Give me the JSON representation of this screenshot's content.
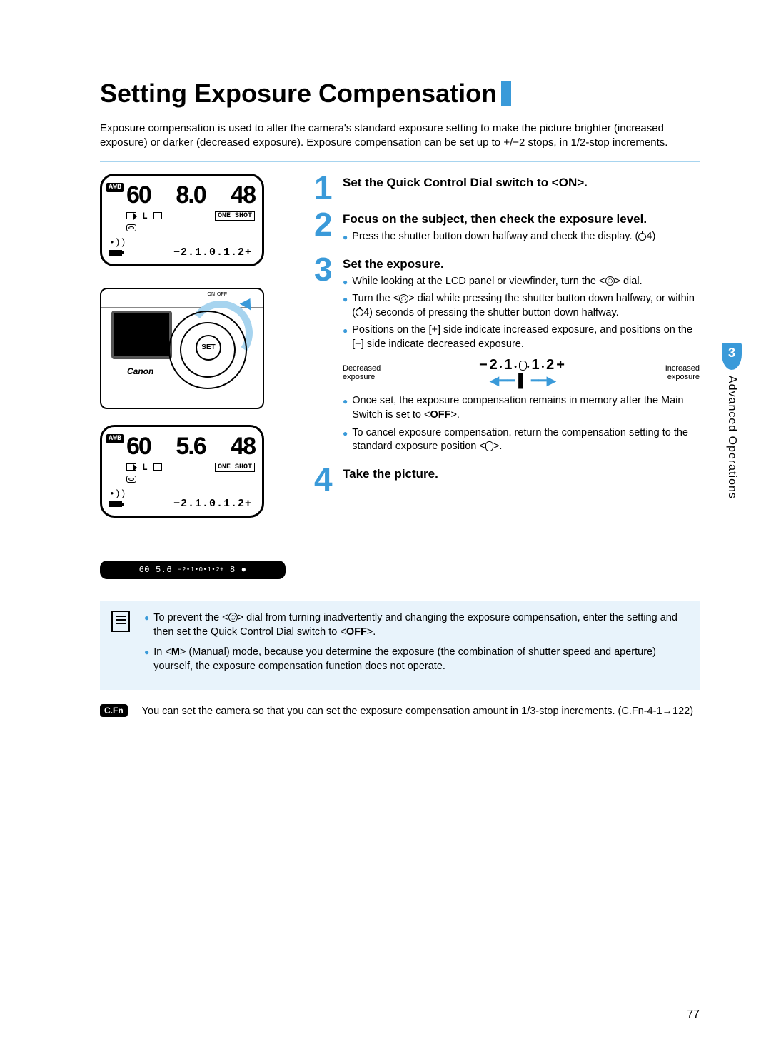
{
  "title": "Setting Exposure Compensation",
  "intro": "Exposure compensation is used to alter the camera's standard exposure setting to make the picture brighter (increased exposure) or darker (decreased exposure). Exposure compensation can be set up to +/−2 stops, in 1/2-stop increments.",
  "lcd1": {
    "awb": "AWB",
    "shutter": "60",
    "aperture": "8.0",
    "shots": "48",
    "oneshot": "ONE SHOT",
    "scale": "−2.1.0.1.2+"
  },
  "camera": {
    "brand": "Canon",
    "set": "SET",
    "switch_on": "ON",
    "switch_off": "OFF"
  },
  "lcd2": {
    "awb": "AWB",
    "shutter": "60",
    "aperture": "5.6",
    "shots": "48",
    "oneshot": "ONE SHOT",
    "scale": "−2.1.0.1.2+"
  },
  "viewfinder": {
    "shutter": "60",
    "aperture": "5.6",
    "scale": "−2•1•0•1•2+",
    "shots": "8",
    "dot": "●"
  },
  "steps": [
    {
      "n": "1",
      "title": "Set the Quick Control Dial switch to <ON>."
    },
    {
      "n": "2",
      "title": "Focus on the subject, then check the exposure level.",
      "bullets": [
        "Press the shutter button down halfway and check the display. (⏱4)"
      ]
    },
    {
      "n": "3",
      "title": "Set the exposure.",
      "bullets": [
        "While looking at the LCD panel or viewfinder, turn the <◎> dial.",
        "Turn the <◎> dial while pressing the shutter button down halfway, or within (⏱4) seconds of pressing the shutter button down halfway.",
        "Positions on the [+] side indicate increased exposure, and positions on the [−] side indicate decreased exposure."
      ],
      "scale": {
        "left": "Decreased\nexposure",
        "right": "Increased\nexposure",
        "value": "−2 • 1 • 0 • 1 • 2+"
      },
      "bullets2": [
        "Once set, the exposure compensation remains in memory after the Main Switch is set to <OFF>.",
        "To cancel exposure compensation, return the compensation setting to the standard exposure position <0>."
      ]
    },
    {
      "n": "4",
      "title": "Take the picture."
    }
  ],
  "notes_box": [
    "To prevent the <◎> dial from turning inadvertently and changing the exposure compensation, enter the setting and then set the Quick Control Dial switch to <OFF>.",
    "In <M> (Manual) mode, because you determine the exposure (the combination of shutter speed and aperture) yourself, the exposure compensation function does not operate."
  ],
  "cfn": {
    "badge": "C.Fn",
    "text": "You can set the camera so that you can set the exposure compensation amount in 1/3-stop increments. (C.Fn-4-1→122)"
  },
  "side": {
    "num": "3",
    "label": "Advanced Operations"
  },
  "page_number": "77"
}
